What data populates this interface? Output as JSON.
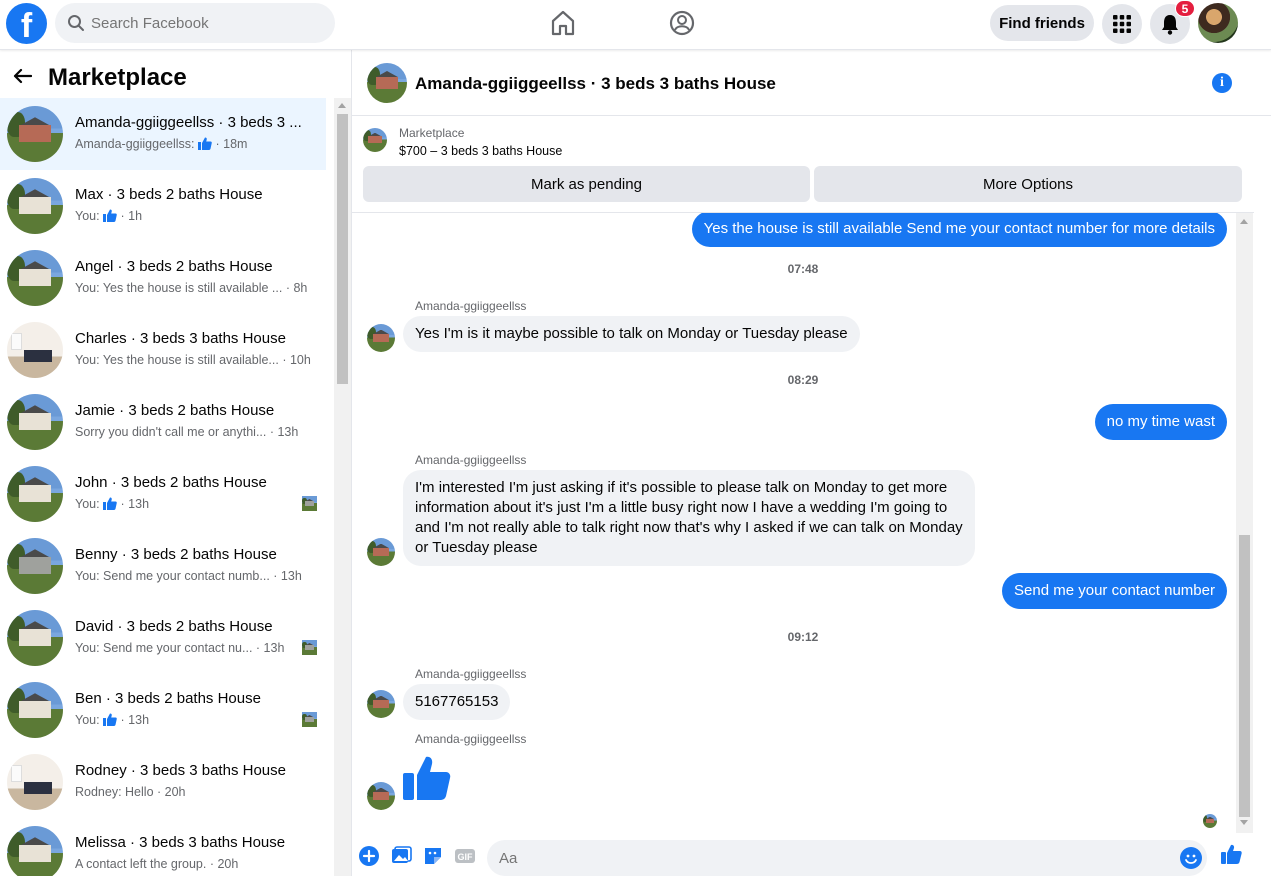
{
  "topbar": {
    "logo": "f",
    "search_placeholder": "Search Facebook",
    "find_friends": "Find friends",
    "notifications_count": "5"
  },
  "sidebar": {
    "title": "Marketplace",
    "conversations": [
      {
        "name": "Amanda-ggiiggeellss · 3 beds 3 ...",
        "snippet_prefix": "Amanda-ggiiggeellss:",
        "has_like": true,
        "time": "· 18m",
        "image": "house-brick",
        "active": true
      },
      {
        "name": "Max · 3 beds 2 baths House",
        "snippet_prefix": "You:",
        "has_like": true,
        "time": "· 1h",
        "image": "house"
      },
      {
        "name": "Angel · 3 beds 2 baths House",
        "snippet_prefix": "You: Yes the house is still available ...",
        "has_like": false,
        "time": "· 8h",
        "image": "house"
      },
      {
        "name": "Charles · 3 beds 3 baths House",
        "snippet_prefix": "You: Yes the house is still available...",
        "has_like": false,
        "time": "· 10h",
        "image": "room"
      },
      {
        "name": "Jamie · 3 beds 2 baths House",
        "snippet_prefix": "Sorry you didn't call me or anythi...",
        "has_like": false,
        "time": "· 13h",
        "image": "house"
      },
      {
        "name": "John · 3 beds 2 baths House",
        "snippet_prefix": "You:",
        "has_like": true,
        "time": "· 13h",
        "image": "house",
        "seen": true
      },
      {
        "name": "Benny · 3 beds 2 baths House",
        "snippet_prefix": "You: Send me your contact numb...",
        "has_like": false,
        "time": "· 13h",
        "image": "house-dark"
      },
      {
        "name": "David · 3 beds 2 baths House",
        "snippet_prefix": "You: Send me your contact nu...",
        "has_like": false,
        "time": "· 13h",
        "image": "house",
        "seen": true
      },
      {
        "name": "Ben · 3 beds 2 baths House",
        "snippet_prefix": "You:",
        "has_like": true,
        "time": "· 13h",
        "image": "house",
        "seen": true
      },
      {
        "name": "Rodney · 3 beds 3 baths House",
        "snippet_prefix": "Rodney: Hello",
        "has_like": false,
        "time": "· 20h",
        "image": "room"
      },
      {
        "name": "Melissa · 3 beds 3 baths House",
        "snippet_prefix": "A contact left the group.",
        "has_like": false,
        "time": "· 20h",
        "image": "house"
      }
    ]
  },
  "chat": {
    "title": "Amanda-ggiiggeellss · 3 beds 3 baths House",
    "listing_label": "Marketplace",
    "listing_price": "$700 – 3 beds 3 baths House",
    "mark_pending": "Mark as pending",
    "more_options": "More Options",
    "messages": {
      "m1": "Yes the house is still available Send me your contact number for more details",
      "t1": "07:48",
      "s1": "Amanda-ggiiggeellss",
      "m2": "Yes I'm is it maybe possible to talk on Monday or Tuesday please",
      "t2": "08:29",
      "m3": "no my time wast",
      "s2": "Amanda-ggiiggeellss",
      "m4_l1": "I'm interested I'm just asking if it's possible to please talk on Monday to get more",
      "m4_l2": "information about it's just I'm a little busy right now I have a wedding I'm going to",
      "m4_l3": "and I'm not really able to talk right now that's why I asked if we can talk on Monday",
      "m4_l4": "or Tuesday please",
      "m5": "Send me your contact number",
      "t3": "09:12",
      "s3": "Amanda-ggiiggeellss",
      "m6": "5167765153",
      "s4": "Amanda-ggiiggeellss"
    },
    "composer_placeholder": "Aa"
  },
  "colors": {
    "brand": "#1877f2",
    "bubble_in": "#f0f2f5",
    "active_row": "#ebf5ff"
  }
}
